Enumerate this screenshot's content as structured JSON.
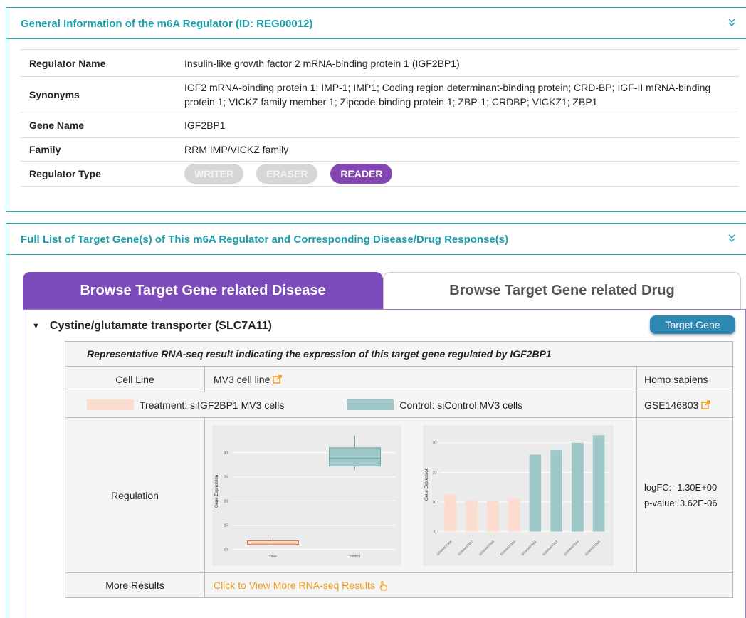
{
  "general": {
    "title": "General Information of the m6A Regulator (ID: REG00012)",
    "rows": {
      "regulator_name": {
        "label": "Regulator Name",
        "value": "Insulin-like growth factor 2 mRNA-binding protein 1 (IGF2BP1)"
      },
      "synonyms": {
        "label": "Synonyms",
        "value": "IGF2 mRNA-binding protein 1; IMP-1; IMP1; Coding region determinant-binding protein; CRD-BP; IGF-II mRNA-binding protein 1; VICKZ family member 1; Zipcode-binding protein 1; ZBP-1; CRDBP; VICKZ1; ZBP1"
      },
      "gene_name": {
        "label": "Gene Name",
        "value": "IGF2BP1"
      },
      "family": {
        "label": "Family",
        "value": "RRM IMP/VICKZ family"
      },
      "regulator_type": {
        "label": "Regulator Type",
        "badges": [
          "WRITER",
          "ERASER",
          "READER"
        ],
        "active": "READER"
      }
    }
  },
  "targets": {
    "title": "Full List of Target Gene(s) of This m6A Regulator and Corresponding Disease/Drug Response(s)",
    "tabs": [
      "Browse Target Gene related Disease",
      "Browse Target Gene related Drug"
    ],
    "active_tab": 0,
    "gene": "Cystine/glutamate transporter (SLC7A11)",
    "target_button": "Target Gene",
    "rnaseq": {
      "title": "Representative RNA-seq result indicating the expression of this target gene regulated by IGF2BP1",
      "cell_line_label": "Cell Line",
      "cell_line": "MV3 cell line",
      "species": "Homo sapiens",
      "treatment": "Treatment: siIGF2BP1 MV3 cells",
      "control": "Control: siControl MV3 cells",
      "dataset": "GSE146803",
      "regulation_label": "Regulation",
      "logfc": "logFC: -1.30E+00",
      "pvalue": "p-value: 3.62E-06",
      "more_label": "More Results",
      "more_link": "Click to View More RNA-seq Results"
    }
  },
  "colors": {
    "accent": "#1a9fab",
    "tab_active": "#7c4cbb",
    "treatment": "#fcdccf",
    "control": "#9fc8c9",
    "link": "#f29b18",
    "button": "#2f87b3"
  },
  "chart_data": [
    {
      "type": "boxplot",
      "ylabel": "Gene Expression",
      "categories": [
        "case",
        "control"
      ],
      "yticks": [
        10,
        15,
        20,
        25,
        30
      ],
      "ylim": [
        9.5,
        34.5
      ],
      "boxes": [
        {
          "name": "case",
          "min": 10.9,
          "q1": 11.0,
          "median": 11.3,
          "q3": 11.8,
          "max": 12.5,
          "color": "#fcdccf"
        },
        {
          "name": "control",
          "min": 26.5,
          "q1": 27.2,
          "median": 28.8,
          "q3": 31.0,
          "max": 33.5,
          "color": "#9fc8c9"
        }
      ]
    },
    {
      "type": "bar",
      "ylabel": "Gene Expression",
      "categories": [
        "GSM4407366",
        "GSM4407367",
        "GSM4407368",
        "GSM4407369",
        "GSM4407362",
        "GSM4407363",
        "GSM4407364",
        "GSM4407365"
      ],
      "values": [
        12.5,
        10.5,
        10.4,
        11.0,
        26.0,
        27.5,
        30.0,
        32.5
      ],
      "groups": [
        "case",
        "case",
        "case",
        "case",
        "control",
        "control",
        "control",
        "control"
      ],
      "yticks": [
        0,
        10,
        20,
        30
      ],
      "ylim": [
        -2,
        34
      ]
    }
  ]
}
